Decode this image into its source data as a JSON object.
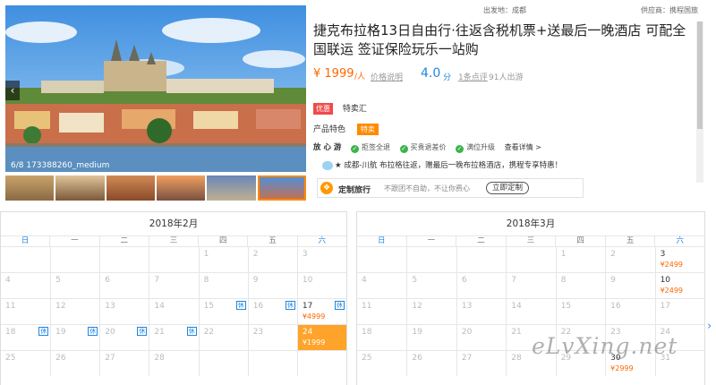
{
  "meta": {
    "departure": "出发地：成都",
    "supplier": "供应商：携程国旅"
  },
  "gallery": {
    "caption": "6/8 173388260_medium",
    "prev_icon": "chevron-left-icon",
    "thumbnails": [
      "thumb-1",
      "thumb-2",
      "thumb-3",
      "thumb-4",
      "thumb-5",
      "thumb-6"
    ]
  },
  "product": {
    "title": "捷克布拉格13日自由行·往返含税机票+送最后一晚酒店 可配全国联运 签证保险玩乐一站购",
    "price": "¥ 1999",
    "price_unit": "/人",
    "price_note": "价格说明",
    "score": "4.0",
    "score_unit": "分",
    "reviews": "1条点评",
    "departed": "91人出游"
  },
  "promo": {
    "tag": "优惠",
    "text": "特卖汇"
  },
  "feature": {
    "label": "产品特色",
    "tag": "特卖"
  },
  "assurance": {
    "label": "放 心 游",
    "items": [
      "拒签全退",
      "买贵退差价",
      "满位升级"
    ],
    "detail_link": "查看详情 >"
  },
  "notice": "★ 成都-川航 布拉格往返，赠最后一晚布拉格酒店，携程专享特惠！",
  "custom": {
    "title": "定制旅行",
    "desc": "不跟团不自助，不让你费心",
    "button": "立即定制"
  },
  "calendar_feb": {
    "title": "2018年2月",
    "weekdays": [
      "日",
      "一",
      "二",
      "三",
      "四",
      "五",
      "六"
    ],
    "cells": [
      {
        "d": ""
      },
      {
        "d": ""
      },
      {
        "d": ""
      },
      {
        "d": ""
      },
      {
        "d": "1"
      },
      {
        "d": "2"
      },
      {
        "d": "3"
      },
      {
        "d": "4"
      },
      {
        "d": "5"
      },
      {
        "d": "6"
      },
      {
        "d": "7"
      },
      {
        "d": "8"
      },
      {
        "d": "9"
      },
      {
        "d": "10"
      },
      {
        "d": "11"
      },
      {
        "d": "12"
      },
      {
        "d": "13"
      },
      {
        "d": "14"
      },
      {
        "d": "15",
        "hol": "休"
      },
      {
        "d": "16",
        "hol": "休"
      },
      {
        "d": "17",
        "p": "¥4999",
        "hol": "休",
        "avail": true
      },
      {
        "d": "18",
        "hol": "休"
      },
      {
        "d": "19",
        "hol": "休"
      },
      {
        "d": "20",
        "hol": "休"
      },
      {
        "d": "21",
        "hol": "休"
      },
      {
        "d": "22"
      },
      {
        "d": "23"
      },
      {
        "d": "24",
        "p": "¥1999",
        "avail": true,
        "sel": true
      },
      {
        "d": "25"
      },
      {
        "d": "26"
      },
      {
        "d": "27"
      },
      {
        "d": "28"
      },
      {
        "d": ""
      },
      {
        "d": ""
      },
      {
        "d": ""
      }
    ]
  },
  "calendar_mar": {
    "title": "2018年3月",
    "weekdays": [
      "日",
      "一",
      "二",
      "三",
      "四",
      "五",
      "六"
    ],
    "cells": [
      {
        "d": ""
      },
      {
        "d": ""
      },
      {
        "d": ""
      },
      {
        "d": ""
      },
      {
        "d": "1"
      },
      {
        "d": "2"
      },
      {
        "d": "3",
        "p": "¥2499",
        "avail": true
      },
      {
        "d": "4"
      },
      {
        "d": "5"
      },
      {
        "d": "6"
      },
      {
        "d": "7"
      },
      {
        "d": "8"
      },
      {
        "d": "9"
      },
      {
        "d": "10",
        "p": "¥2499",
        "avail": true
      },
      {
        "d": "11"
      },
      {
        "d": "12"
      },
      {
        "d": "13"
      },
      {
        "d": "14"
      },
      {
        "d": "15"
      },
      {
        "d": "16"
      },
      {
        "d": "17"
      },
      {
        "d": "18"
      },
      {
        "d": "19"
      },
      {
        "d": "20"
      },
      {
        "d": "21"
      },
      {
        "d": "22"
      },
      {
        "d": "23"
      },
      {
        "d": "24"
      },
      {
        "d": "25"
      },
      {
        "d": "26"
      },
      {
        "d": "27"
      },
      {
        "d": "28"
      },
      {
        "d": "29"
      },
      {
        "d": "30",
        "p": "¥2999",
        "avail": true
      },
      {
        "d": "31"
      }
    ]
  },
  "next_icon": "chevron-right-icon",
  "watermark": "eLvXing.net"
}
